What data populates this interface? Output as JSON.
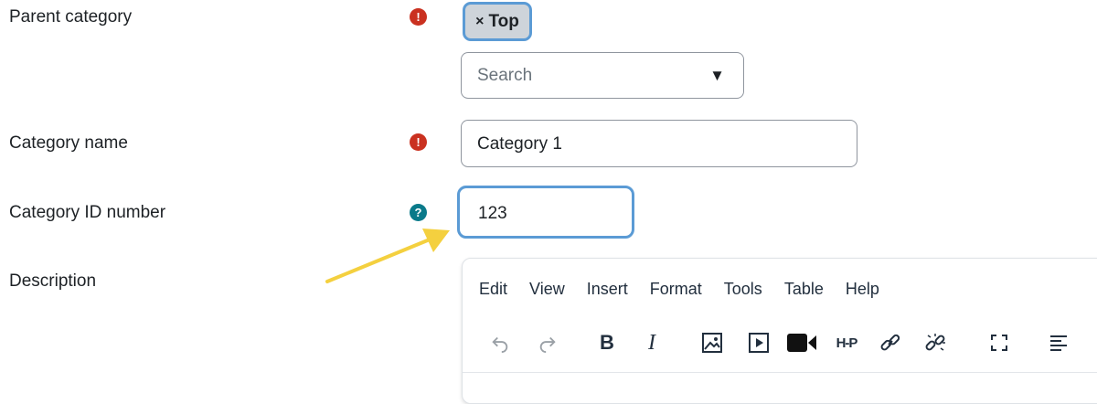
{
  "form": {
    "parent_category": {
      "label": "Parent category",
      "chip": {
        "remove_glyph": "×",
        "text": "Top"
      },
      "search_placeholder": "Search",
      "dropdown_glyph": "▼"
    },
    "category_name": {
      "label": "Category name",
      "value": "Category 1"
    },
    "category_id": {
      "label": "Category ID number",
      "value": "123"
    },
    "description": {
      "label": "Description"
    },
    "required_glyph": "!",
    "help_glyph": "?"
  },
  "editor": {
    "menu": [
      "Edit",
      "View",
      "Insert",
      "Format",
      "Tools",
      "Table",
      "Help"
    ],
    "toolbar_icons": [
      "undo-icon",
      "redo-icon",
      "bold-icon",
      "italic-icon",
      "image-icon",
      "media-icon",
      "video-record-icon",
      "h5p-icon",
      "link-icon",
      "unlink-icon",
      "fullscreen-icon",
      "align-left-icon"
    ],
    "bold_glyph": "B",
    "italic_glyph": "I",
    "h5p_text": "H-P"
  },
  "colors": {
    "required": "#ca3120",
    "help": "#0a7a8a",
    "focus": "#5b9bd5",
    "annotation_arrow": "#f4d03f"
  }
}
